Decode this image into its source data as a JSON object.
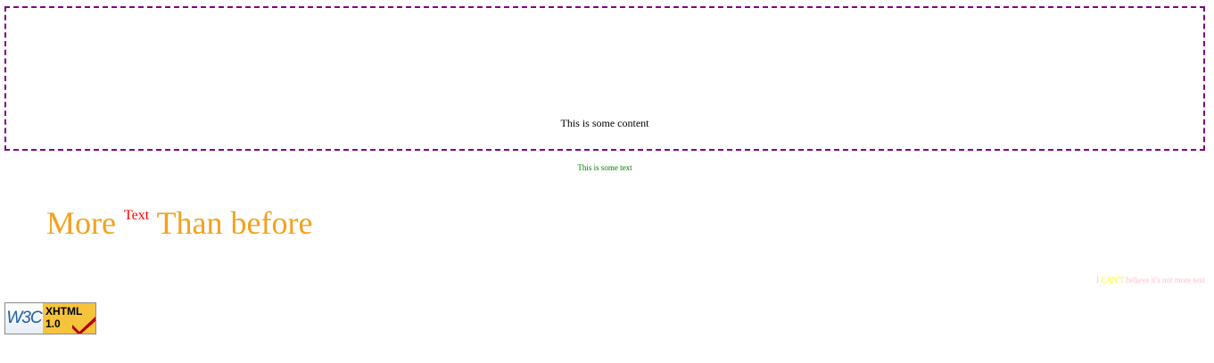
{
  "content_box": {
    "text": "This is some content",
    "border_color": "#800080"
  },
  "green_text": {
    "text": "This is some text",
    "color": "#008000"
  },
  "big_line": {
    "part1": "More",
    "sup": "Text",
    "part2": "Than before",
    "main_color": "#f2a11f",
    "sup_color": "#ff0000"
  },
  "tiny_line": {
    "part1": "I",
    "emphasis": "CAN'T",
    "part2": "believe it's not more text",
    "colors": {
      "normal": "#ffc0cb",
      "emphasis": "#ffff00"
    }
  },
  "badge": {
    "logo": "W3C",
    "line1": "XHTML",
    "line2": "1.0",
    "icon": "checkmark-icon"
  }
}
